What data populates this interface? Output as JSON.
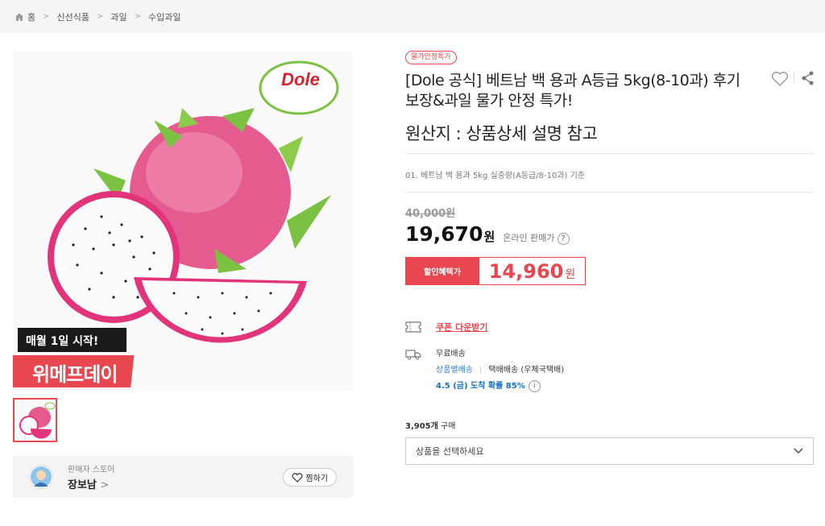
{
  "breadcrumb": [
    "홈",
    "신선식품",
    "과일",
    "수입과일"
  ],
  "image": {
    "logo_text": "Dole",
    "promo_line1": "매월 1일 시작!",
    "promo_line2": "위메프데이"
  },
  "seller": {
    "caption": "판매자 스토어",
    "name": "장보남",
    "fav_label": "찜하기"
  },
  "product": {
    "badge": "물가안정특가",
    "title": "[Dole 공식] 베트남 백 용과 A등급 5kg(8-10과) 후기 보장&과일 물가 안정 특가!",
    "origin": "원산지 : 상품상세 설명 참고",
    "option_note": "01. 베트남 백 용과 5kg 실중량(A등급/8-10과) 기준"
  },
  "price": {
    "original": "40,000원",
    "sale": "19,670",
    "won": "원",
    "online_label": "온라인 판매가",
    "benefit_label": "할인혜택가",
    "benefit_price": "14,960",
    "benefit_won": "원"
  },
  "coupon": {
    "label": "쿠폰 다운받기"
  },
  "shipping": {
    "fee": "무료배송",
    "method": "상품별배송",
    "carrier": "택배배송 (우체국택배)",
    "eta": "4.5 (금) 도착 확률 85%"
  },
  "purchase": {
    "count": "3,905개",
    "label": "구매"
  },
  "select": {
    "placeholder": "상품을 선택하세요"
  },
  "colors": {
    "accent": "#e8474f",
    "link_blue": "#1a6fc4"
  }
}
